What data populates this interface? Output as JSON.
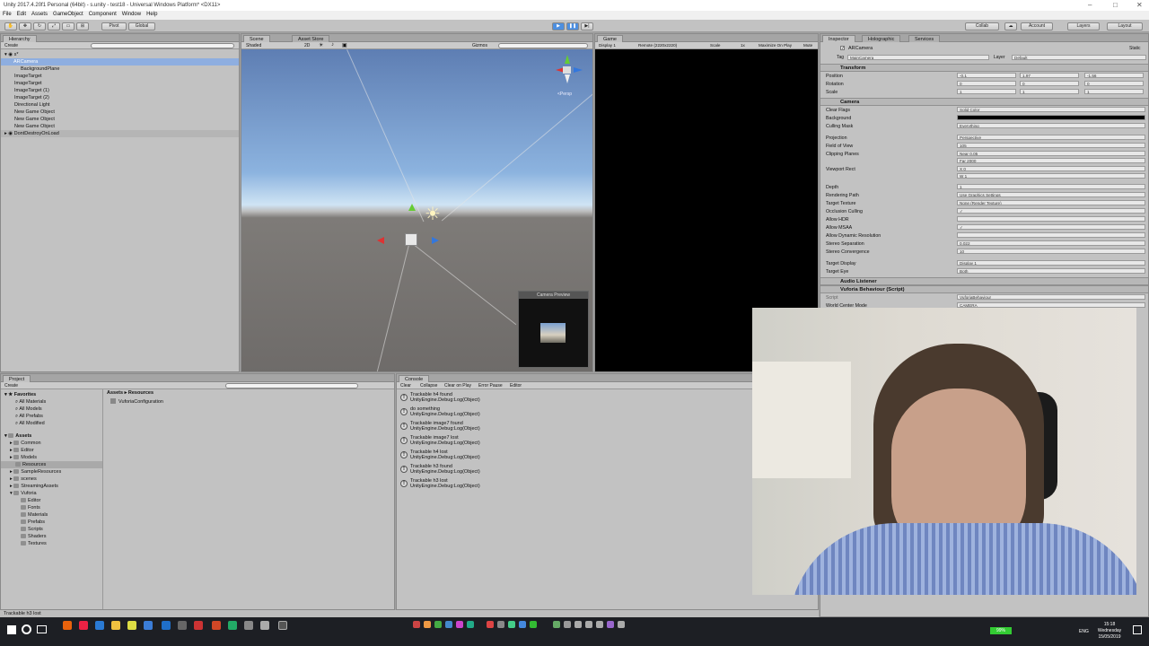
{
  "window_title": "Unity 2017.4.20f1 Personal (64bit) - s.unity - test18 - Universal Windows Platform* <DX11>",
  "menu": [
    "File",
    "Edit",
    "Assets",
    "GameObject",
    "Component",
    "Window",
    "Help"
  ],
  "toolbar": {
    "pivot": "Pivot",
    "global": "Global",
    "collab": "Collab",
    "account": "Account",
    "layers": "Layers",
    "layout": "Layout"
  },
  "hierarchy": {
    "tab": "Hierarchy",
    "create": "Create",
    "scene": "s*",
    "items": [
      "ARCamera",
      "BackgroundPlane",
      "ImageTarget",
      "ImageTarget",
      "ImageTarget (1)",
      "ImageTarget (2)",
      "Directional Light",
      "New Game Object",
      "New Game Object",
      "New Game Object"
    ],
    "dontdestroy": "DontDestroyOnLoad"
  },
  "scene": {
    "tabs": [
      "Scene",
      "Asset Store"
    ],
    "shading": "Shaded",
    "mode2d": "2D",
    "gizmos": "Gizmos",
    "persp": "<Persp",
    "camera_preview": "Camera Preview"
  },
  "game": {
    "tab": "Game",
    "display": "Display 1",
    "resolution": "Remote (2220x2220)",
    "scale": "Scale",
    "scale_val": "1x",
    "max": "Maximize On Play",
    "mute": "Mute"
  },
  "inspector": {
    "tabs": [
      "Inspector",
      "Holographic",
      "Services"
    ],
    "object_name": "ARCamera",
    "static": "Static",
    "tag_label": "Tag",
    "tag": "MainCamera",
    "layer_label": "Layer",
    "layer": "Default",
    "transform": {
      "title": "Transform",
      "position": {
        "label": "Position",
        "x": "-0.1",
        "y": "1.97",
        "z": "-1.56"
      },
      "rotation": {
        "label": "Rotation",
        "x": "0",
        "y": "0",
        "z": "0"
      },
      "scale": {
        "label": "Scale",
        "x": "1",
        "y": "1",
        "z": "1"
      }
    },
    "camera": {
      "title": "Camera",
      "fields": [
        {
          "label": "Clear Flags",
          "value": "Solid Color"
        },
        {
          "label": "Background",
          "value": ""
        },
        {
          "label": "Culling Mask",
          "value": "Everything"
        },
        {
          "label": "Projection",
          "value": "Perspective"
        },
        {
          "label": "Field of View",
          "value": "105"
        },
        {
          "label": "Clipping Planes",
          "value": "Near 0.05"
        },
        {
          "label": "",
          "value": "Far 2000"
        },
        {
          "label": "Viewport Rect",
          "value": "X 0"
        },
        {
          "label": "",
          "value": "W 1"
        },
        {
          "label": "Depth",
          "value": "1"
        },
        {
          "label": "Rendering Path",
          "value": "Use Graphics Settings"
        },
        {
          "label": "Target Texture",
          "value": "None (Render Texture)"
        },
        {
          "label": "Occlusion Culling",
          "value": "✓"
        },
        {
          "label": "Allow HDR",
          "value": ""
        },
        {
          "label": "Allow MSAA",
          "value": "✓"
        },
        {
          "label": "Allow Dynamic Resolution",
          "value": ""
        },
        {
          "label": "Stereo Separation",
          "value": "0.022"
        },
        {
          "label": "Stereo Convergence",
          "value": "10"
        },
        {
          "label": "Target Display",
          "value": "Display 1"
        },
        {
          "label": "Target Eye",
          "value": "Both"
        }
      ]
    },
    "audio_listener": "Audio Listener",
    "vuforia": "Vuforia Behaviour (Script)",
    "script_label": "Script",
    "script_value": "VuforiaBehaviour",
    "world_center": "World Center Mode",
    "world_center_value": "CAMERA"
  },
  "project": {
    "tab": "Project",
    "create": "Create",
    "favorites": "Favorites",
    "fav_items": [
      "All Materials",
      "All Models",
      "All Prefabs",
      "All Modified"
    ],
    "assets": "Assets",
    "asset_items": [
      "Common",
      "Editor",
      "Models",
      "Resources",
      "SampleResources",
      "scenes",
      "StreamingAssets",
      "Vuforia"
    ],
    "vuforia_items": [
      "Editor",
      "Fonts",
      "Materials",
      "Prefabs",
      "Scripts",
      "Shaders",
      "Textures"
    ],
    "breadcrumb": [
      "Assets",
      "Resources"
    ],
    "file": "VuforiaConfiguration"
  },
  "console": {
    "tab": "Console",
    "buttons": [
      "Clear",
      "Collapse",
      "Clear on Play",
      "Error Pause",
      "Editor"
    ],
    "logs": [
      {
        "t1": "Trackable h4 found",
        "t2": "UnityEngine.Debug:Log(Object)"
      },
      {
        "t1": "do something",
        "t2": "UnityEngine.Debug:Log(Object)"
      },
      {
        "t1": "Trackable image7 found",
        "t2": "UnityEngine.Debug:Log(Object)"
      },
      {
        "t1": "Trackable image7 lost",
        "t2": "UnityEngine.Debug:Log(Object)"
      },
      {
        "t1": "Trackable h4 lost",
        "t2": "UnityEngine.Debug:Log(Object)"
      },
      {
        "t1": "Trackable h3 found",
        "t2": "UnityEngine.Debug:Log(Object)"
      },
      {
        "t1": "Trackable h3 lost",
        "t2": "UnityEngine.Debug:Log(Object)"
      }
    ]
  },
  "status": "Trackable h3 lost",
  "taskbar": {
    "battery": "99%",
    "lang": "ENG",
    "time": "15:18",
    "day": "Wednesday",
    "date": "15/05/2019"
  }
}
